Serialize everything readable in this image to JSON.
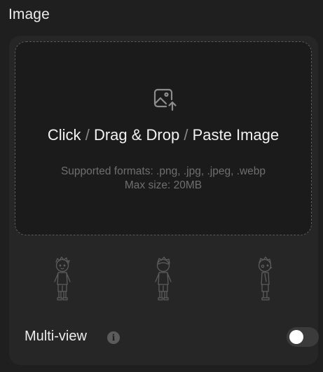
{
  "section": {
    "title": "Image"
  },
  "dropzone": {
    "action_click": "Click",
    "separator": "/",
    "action_drag": "Drag & Drop",
    "action_paste": "Paste Image",
    "formats": "Supported formats: .png, .jpg, .jpeg, .webp",
    "max_size": "Max size: 20MB",
    "icon": "image-upload-icon"
  },
  "views": [
    {
      "name": "front-view",
      "icon": "character-front-icon"
    },
    {
      "name": "back-view",
      "icon": "character-back-icon"
    },
    {
      "name": "side-view",
      "icon": "character-side-icon"
    }
  ],
  "multiview": {
    "label": "Multi-view",
    "info_icon": "info-icon",
    "enabled": false
  },
  "colors": {
    "background": "#1f1f1f",
    "panel": "#262626",
    "dropzone": "#1b1b1b",
    "muted_text": "#6f6f6f"
  }
}
